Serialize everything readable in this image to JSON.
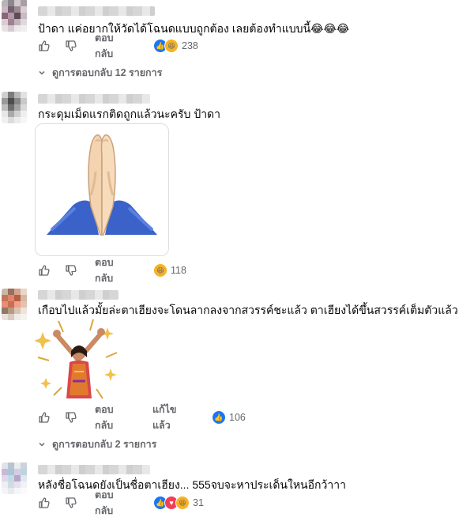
{
  "comments": [
    {
      "text": "ป้าดา แค่อยากให้วัดได้โฉนดแบบถูกต้อง เลยต้องทำแบบนี้😂😂😂",
      "like_label": "like",
      "dislike_label": "dislike",
      "reply_label": "ตอบกลับ",
      "reaction_count": "238",
      "replies_label": "ดูการตอบกลับ 12 รายการ"
    },
    {
      "text": "กระดุมเม็ดแรกติดถูกแล้วนะครับ ป้าดา",
      "sticker_name": "folded-hands-emoji",
      "reply_label": "ตอบกลับ",
      "reaction_count": "118"
    },
    {
      "text": "เกือบไปแล้วมั้ยล่ะตาเฮียงจะโดนลากลงจากสวรรค์ชะแล้ว ตาเฮียงได้ขึ้นสวรรค์เต็มตัวแล้ว",
      "reply_label": "ตอบกลับ",
      "edited_label": "แก้ไขแล้ว",
      "reaction_count": "106",
      "replies_label": "ดูการตอบกลับ 2 รายการ"
    },
    {
      "text": "หลังชื่อโฉนดยังเป็นชื่อตาเฮียง... 555จบจะหาประเด็นใหนอีกว้าาา",
      "reply_label": "ตอบกลับ",
      "reaction_count": "31"
    }
  ],
  "colors": {
    "accent": "#1877f2",
    "secondary_text": "#65676b",
    "haha": "#f7b125",
    "love": "#f33e58"
  }
}
